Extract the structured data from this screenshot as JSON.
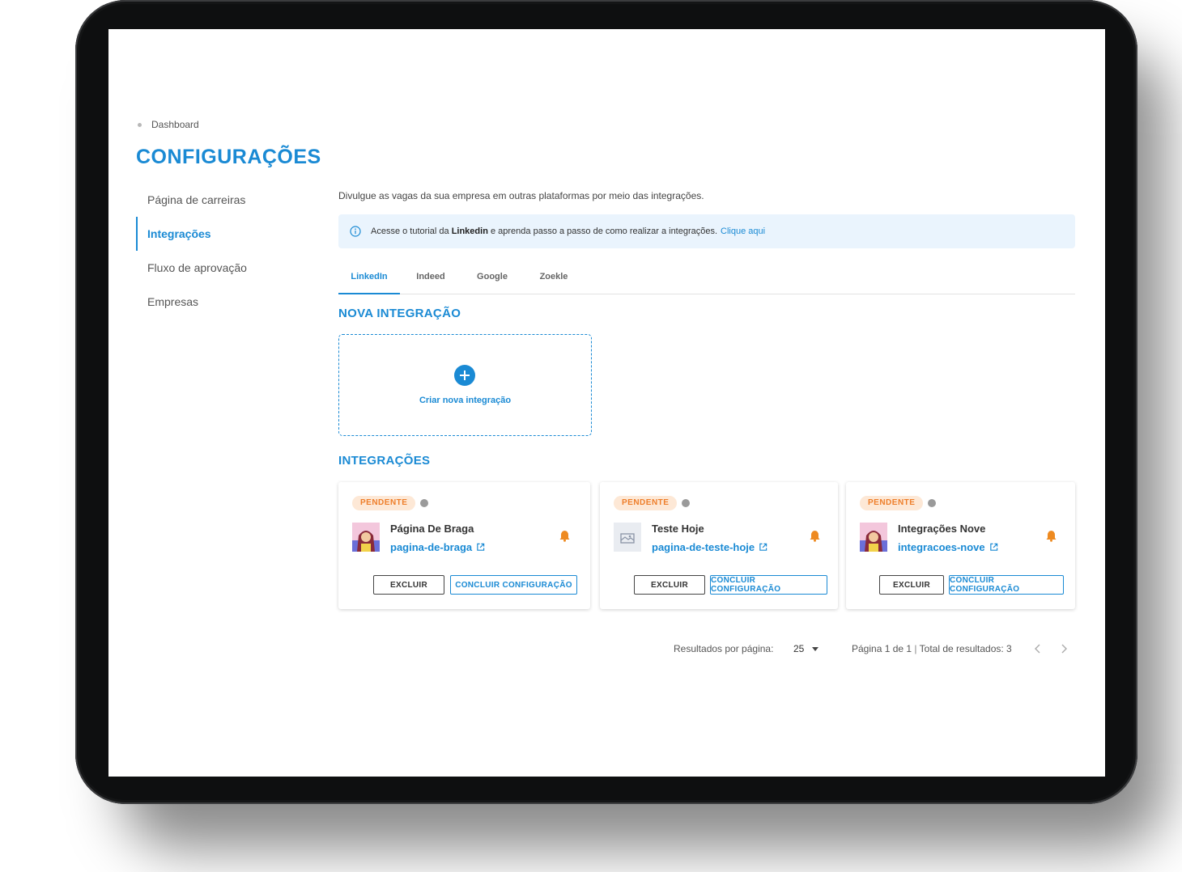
{
  "breadcrumb": {
    "label": "Dashboard"
  },
  "page_title": "CONFIGURAÇÕES",
  "sidebar": {
    "items": [
      {
        "label": "Página de carreiras",
        "active": false
      },
      {
        "label": "Integrações",
        "active": true
      },
      {
        "label": "Fluxo de aprovação",
        "active": false
      },
      {
        "label": "Empresas",
        "active": false
      }
    ]
  },
  "main": {
    "intro": "Divulgue as vagas da sua empresa em outras plataformas por meio das integrações.",
    "banner": {
      "before": "Acesse o tutorial da",
      "strong": "Linkedin",
      "after": "e aprenda passo a passo de como realizar a integrações.",
      "link": "Clique aqui"
    },
    "tabs": [
      {
        "label": "LinkedIn",
        "active": true
      },
      {
        "label": "Indeed",
        "active": false
      },
      {
        "label": "Google",
        "active": false
      },
      {
        "label": "Zoekle",
        "active": false
      }
    ],
    "new_section_title": "NOVA INTEGRAÇÃO",
    "new_integration_label": "Criar nova integração",
    "integrations_title": "INTEGRAÇÕES",
    "cards": [
      {
        "status": "PENDENTE",
        "name": "Página De Braga",
        "slug": "pagina-de-braga",
        "avatar": "character",
        "delete_label": "EXCLUIR",
        "finish_label": "CONCLUIR CONFIGURAÇÃO"
      },
      {
        "status": "PENDENTE",
        "name": "Teste Hoje",
        "slug": "pagina-de-teste-hoje",
        "avatar": "placeholder-image",
        "delete_label": "EXCLUIR",
        "finish_label": "CONCLUIR CONFIGURAÇÃO"
      },
      {
        "status": "PENDENTE",
        "name": "Integrações Nove",
        "slug": "integracoes-nove",
        "avatar": "character",
        "delete_label": "EXCLUIR",
        "finish_label": "CONCLUIR CONFIGURAÇÃO"
      }
    ]
  },
  "pagination": {
    "per_page_label": "Resultados por página:",
    "per_page_value": "25",
    "page_info": "Página 1 de 1",
    "total_info": "Total de resultados: 3"
  },
  "colors": {
    "accent": "#1a8ad4",
    "pending_text": "#ee7e2a",
    "pending_bg": "#fde8d6",
    "banner_bg": "#eaf4fd"
  }
}
